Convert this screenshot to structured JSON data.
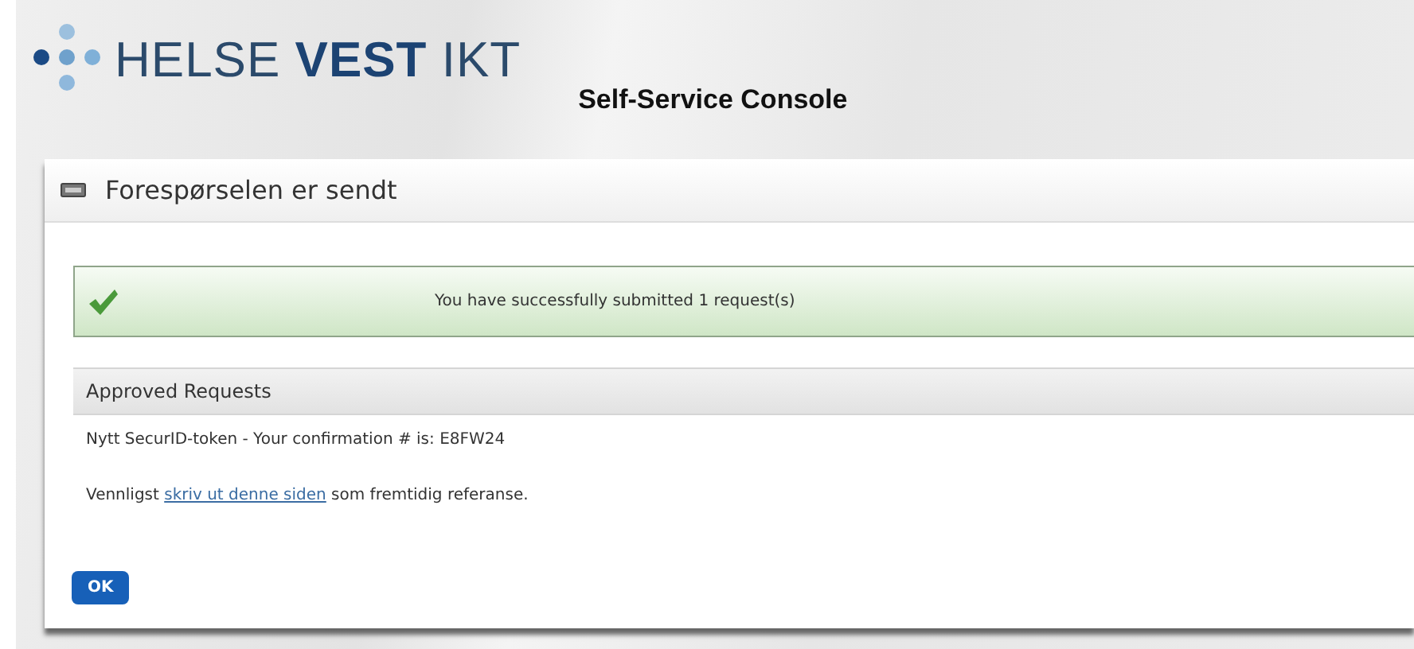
{
  "header": {
    "logo": {
      "part_1": "HELSE",
      "part_2": "VEST",
      "part_3": "IKT"
    },
    "title": "Self-Service Console"
  },
  "panel": {
    "title": "Forespørselen er sendt",
    "message": {
      "kind": "success",
      "text": "You have successfully submitted 1 request(s)"
    },
    "section": {
      "title": "Approved Requests",
      "lines": [
        {
          "kind": "text",
          "text": "Nytt SecurID-token - Your confirmation # is: E8FW24"
        },
        {
          "kind": "link_sentence",
          "before": "Vennligst",
          "link": "skriv ut denne siden",
          "after": "som fremtidig referanse."
        }
      ]
    },
    "button": "OK"
  }
}
